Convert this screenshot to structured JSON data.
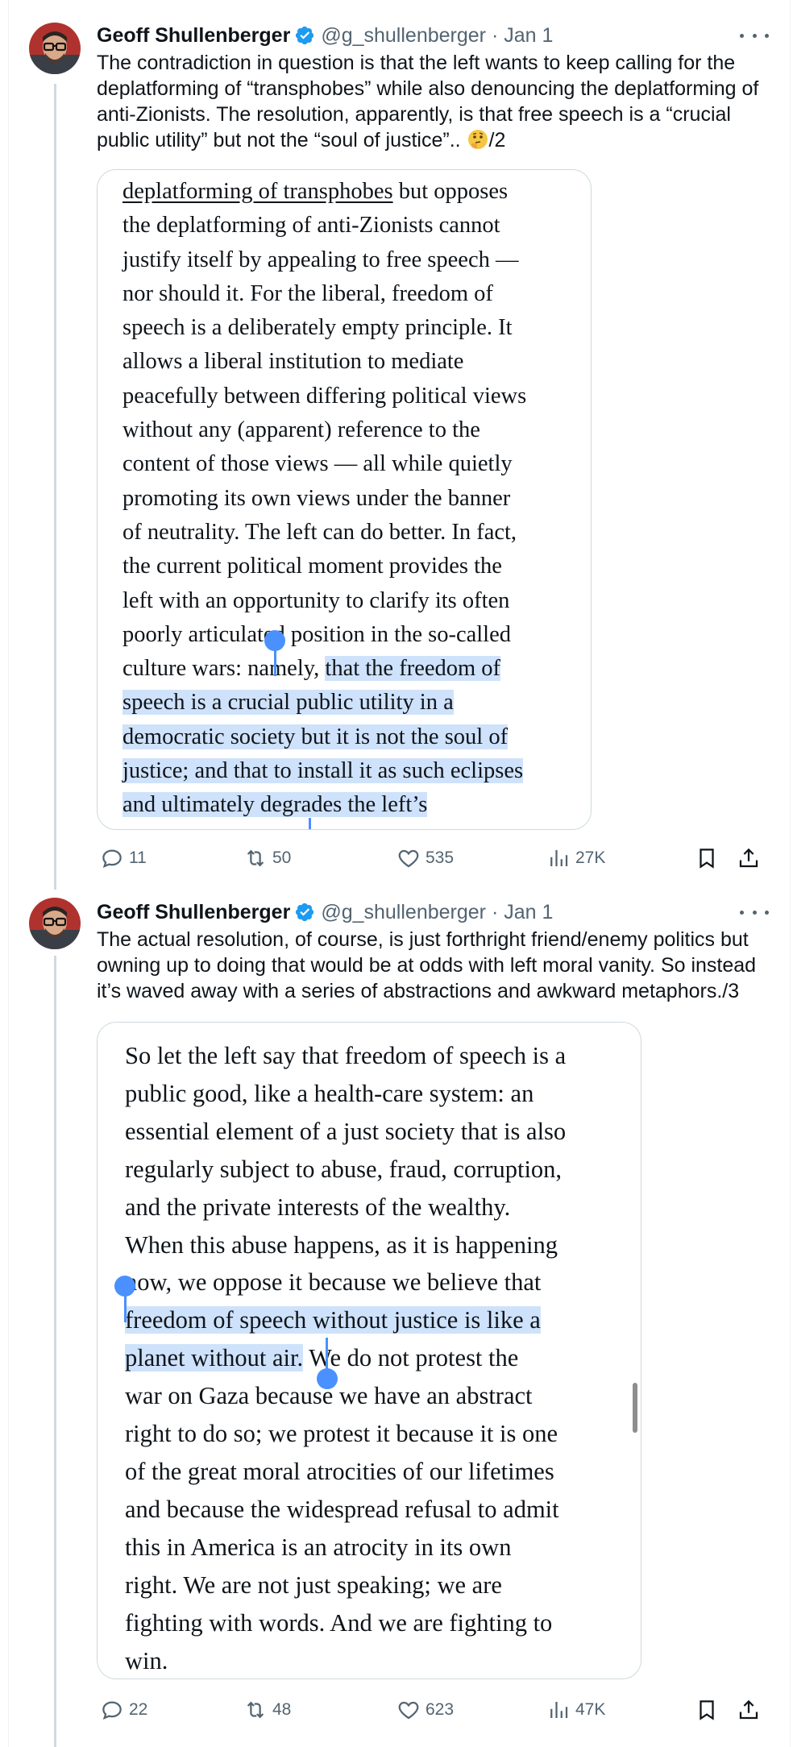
{
  "tweets": [
    {
      "author": {
        "name": "Geoff Shullenberger",
        "handle": "@g_shullenberger",
        "date": "· Jan 1",
        "verified": true
      },
      "text": "The contradiction in question is that the left wants to keep calling for the deplatforming of “transphobes” while also denouncing the deplatforming of anti-Zionists. The resolution, apparently, is that free speech is a “crucial public utility” but not the “soul of justice”.. ",
      "text_suffix": "/2",
      "emoji": "thinking-face",
      "quote_lines": [
        [
          {
            "t": "deplatforming of transphobes",
            "u": true
          },
          {
            "t": " but opposes"
          }
        ],
        [
          {
            "t": "the deplatforming of anti-Zionists cannot"
          }
        ],
        [
          {
            "t": "justify itself by appealing to free speech —"
          }
        ],
        [
          {
            "t": "nor should it. For the liberal, freedom of"
          }
        ],
        [
          {
            "t": "speech is a deliberately empty principle. It"
          }
        ],
        [
          {
            "t": "allows a liberal institution to mediate"
          }
        ],
        [
          {
            "t": "peacefully between differing political views"
          }
        ],
        [
          {
            "t": "without any (apparent) reference to the"
          }
        ],
        [
          {
            "t": "content of those views — all while quietly"
          }
        ],
        [
          {
            "t": "promoting its own views under the banner"
          }
        ],
        [
          {
            "t": "of neutrality. The left can do better. In fact,"
          }
        ],
        [
          {
            "t": "the current political moment provides the"
          }
        ],
        [
          {
            "t": "left with an opportunity to clarify its often"
          }
        ],
        [
          {
            "t": "poorly articulated position in the so-called"
          }
        ],
        [
          {
            "t": "culture wars: namely, "
          },
          {
            "t": "that the freedom of",
            "h": true
          }
        ],
        [
          {
            "t": "speech is a crucial public utility in a",
            "h": true
          }
        ],
        [
          {
            "t": "democratic society but it is not the soul of",
            "h": true
          }
        ],
        [
          {
            "t": "justice; and that to install it as such eclipses",
            "h": true
          }
        ],
        [
          {
            "t": "and ultimately degrades the left’s",
            "h": true
          }
        ]
      ],
      "stats": {
        "replies": "11",
        "reposts": "50",
        "likes": "535",
        "views": "27K"
      }
    },
    {
      "author": {
        "name": "Geoff Shullenberger",
        "handle": "@g_shullenberger",
        "date": "· Jan 1",
        "verified": true
      },
      "text": "The actual resolution, of course, is just forthright friend/enemy politics but owning up to doing that would be at odds with left moral vanity. So instead it’s waved away with a series of abstractions and awkward metaphors./3",
      "quote_lines": [
        [
          {
            "t": "So let the left say that freedom of speech is a"
          }
        ],
        [
          {
            "t": "public good, like a health-care system: an"
          }
        ],
        [
          {
            "t": "essential element of a just society that is also"
          }
        ],
        [
          {
            "t": "regularly subject to abuse, fraud, corruption,"
          }
        ],
        [
          {
            "t": "and the private interests of the wealthy."
          }
        ],
        [
          {
            "t": "When this abuse happens, as it is happening"
          }
        ],
        [
          {
            "t": "now, we oppose it because we believe that"
          }
        ],
        [
          {
            "t": "freedom of speech without justice is like a",
            "h": true
          }
        ],
        [
          {
            "t": "planet without air.",
            "h": true
          },
          {
            "t": " We do not protest the"
          }
        ],
        [
          {
            "t": "war on Gaza because we have an abstract"
          }
        ],
        [
          {
            "t": "right to do so; we protest it because it is one"
          }
        ],
        [
          {
            "t": "of the great moral atrocities of our lifetimes"
          }
        ],
        [
          {
            "t": "and because the widespread refusal to admit"
          }
        ],
        [
          {
            "t": "this in America is an atrocity in its own"
          }
        ],
        [
          {
            "t": "right. We are not just speaking; we are"
          }
        ],
        [
          {
            "t": "fighting with words. And we are fighting to"
          }
        ],
        [
          {
            "t": "win."
          }
        ]
      ],
      "stats": {
        "replies": "22",
        "reposts": "48",
        "likes": "623",
        "views": "47K"
      }
    }
  ],
  "icons": {
    "verified": "verified-badge-icon",
    "more": "more-options-icon",
    "reply": "reply-icon",
    "repost": "repost-icon",
    "like": "heart-icon",
    "views": "analytics-icon",
    "bookmark": "bookmark-icon",
    "share": "share-icon"
  },
  "colors": {
    "accent": "#1d9bf0",
    "selection": "#cfe2fb",
    "selection_handle": "#4a90ff",
    "secondary_text": "#536471"
  }
}
